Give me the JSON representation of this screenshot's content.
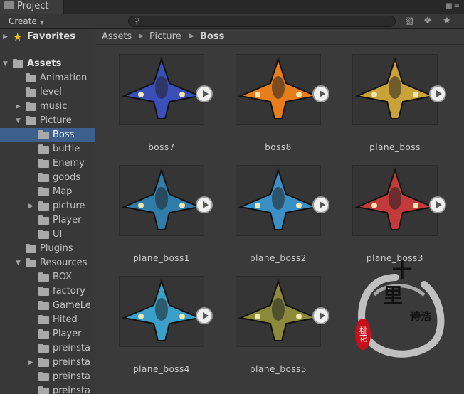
{
  "window": {
    "tab_title": "Project"
  },
  "toolbar": {
    "create_label": "Create",
    "search_placeholder": "",
    "icons": [
      "filter-icon",
      "label-icon",
      "star-icon"
    ]
  },
  "tree": {
    "favorites_label": "Favorites",
    "items": [
      {
        "label": "Assets",
        "depth": 0,
        "expanded": true,
        "bold": true
      },
      {
        "label": "Animation",
        "depth": 1
      },
      {
        "label": "level",
        "depth": 1
      },
      {
        "label": "music",
        "depth": 1,
        "collapsed": true
      },
      {
        "label": "Picture",
        "depth": 1,
        "expanded": true
      },
      {
        "label": "Boss",
        "depth": 2,
        "selected": true
      },
      {
        "label": "buttle",
        "depth": 2
      },
      {
        "label": "Enemy",
        "depth": 2
      },
      {
        "label": "goods",
        "depth": 2
      },
      {
        "label": "Map",
        "depth": 2
      },
      {
        "label": "picture",
        "depth": 2,
        "collapsed": true
      },
      {
        "label": "Player",
        "depth": 2
      },
      {
        "label": "UI",
        "depth": 2
      },
      {
        "label": "Plugins",
        "depth": 1
      },
      {
        "label": "Resources",
        "depth": 1,
        "expanded": true
      },
      {
        "label": "BOX",
        "depth": 2
      },
      {
        "label": "factory",
        "depth": 2
      },
      {
        "label": "GameLe",
        "depth": 2
      },
      {
        "label": "Hited",
        "depth": 2
      },
      {
        "label": "Player",
        "depth": 2
      },
      {
        "label": "preinsta",
        "depth": 2
      },
      {
        "label": "preinsta",
        "depth": 2,
        "collapsed": true
      },
      {
        "label": "preinsta",
        "depth": 2
      },
      {
        "label": "preinsta",
        "depth": 2
      }
    ]
  },
  "breadcrumb": [
    "Assets",
    "Picture",
    "Boss"
  ],
  "assets": [
    {
      "name": "boss7",
      "palette": "#3a4fb8"
    },
    {
      "name": "boss8",
      "palette": "#e87d1c"
    },
    {
      "name": "plane_boss",
      "palette": "#c9a23a"
    },
    {
      "name": "plane_boss1",
      "palette": "#2f7da8"
    },
    {
      "name": "plane_boss2",
      "palette": "#3a8fc4"
    },
    {
      "name": "plane_boss3",
      "palette": "#c23a3a"
    },
    {
      "name": "plane_boss4",
      "palette": "#3aa0c9"
    },
    {
      "name": "plane_boss5",
      "palette": "#8a8a3a"
    }
  ],
  "watermark": {
    "line1": "十",
    "line2": "里",
    "side": "诗浩",
    "seal": "桃花"
  }
}
